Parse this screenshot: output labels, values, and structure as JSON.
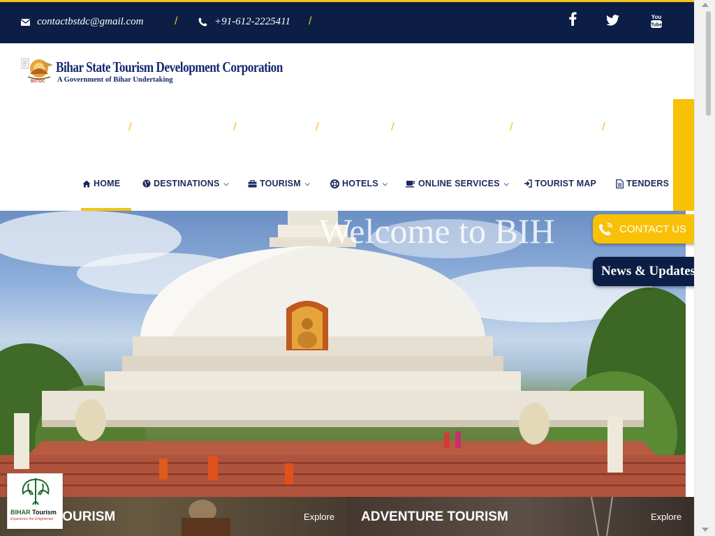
{
  "topbar": {
    "email": "contactbstdc@gmail.com",
    "phone": "+91-612-2225411",
    "social": [
      {
        "icon": "facebook-icon",
        "glyph": "f"
      },
      {
        "icon": "twitter-icon",
        "glyph": "twitter"
      },
      {
        "icon": "youtube-icon",
        "glyph": "You Tube"
      }
    ]
  },
  "brand": {
    "name": "Bihar State Tourism Development Corporation",
    "tagline": "A Government of Bihar Undertaking",
    "abbr": "BSTDC"
  },
  "nav": {
    "items": [
      {
        "label": "HOME",
        "icon": "home-icon",
        "dropdown": false
      },
      {
        "label": "DESTINATIONS",
        "icon": "globe-icon",
        "dropdown": true
      },
      {
        "label": "TOURISM",
        "icon": "briefcase-icon",
        "dropdown": true
      },
      {
        "label": "HOTELS",
        "icon": "lifebuoy-icon",
        "dropdown": true
      },
      {
        "label": "ONLINE SERVICES",
        "icon": "coffee-icon",
        "dropdown": true
      },
      {
        "label": "TOURIST MAP",
        "icon": "sign-in-icon",
        "dropdown": false
      },
      {
        "label": "TENDERS",
        "icon": "file-icon",
        "dropdown": false
      }
    ],
    "active": "HOME"
  },
  "hero": {
    "title": "Welcome to BIH"
  },
  "floating": {
    "contact_label": "CONTACT US",
    "news_label": "News & Updates"
  },
  "cards": [
    {
      "label": "TOURISM",
      "explore": "Explore"
    },
    {
      "label": "ADVENTURE TOURISM",
      "explore": "Explore"
    }
  ],
  "badge": {
    "word1": "BIHAR",
    "word2": "Tourism",
    "tagline": "Experience the Enlightened"
  },
  "colors": {
    "navy": "#0c1e45",
    "accent": "#f5c315",
    "nav_text": "#1b2a5c"
  }
}
